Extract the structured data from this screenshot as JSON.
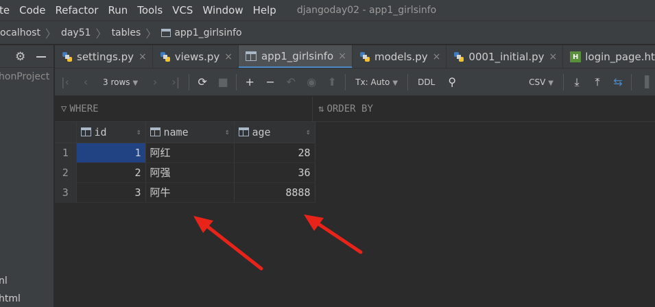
{
  "menu": {
    "items": [
      "te",
      "Code",
      "Refactor",
      "Run",
      "Tools",
      "VCS",
      "Window",
      "Help"
    ],
    "window_title": "djangoday02 - app1_girlsinfo"
  },
  "breadcrumb": {
    "items": [
      "ocalhost",
      "day51",
      "tables",
      "app1_girlsinfo"
    ]
  },
  "project_panel": {
    "project_label": "honProject",
    "file1": "nl",
    "file2": "html"
  },
  "tabs": [
    {
      "label": "settings.py",
      "icon": "python-file-icon",
      "close": "×"
    },
    {
      "label": "views.py",
      "icon": "python-file-icon",
      "close": "×"
    },
    {
      "label": "app1_girlsinfo",
      "icon": "table-icon",
      "close": "×",
      "active": true
    },
    {
      "label": "models.py",
      "icon": "python-file-icon",
      "close": "×"
    },
    {
      "label": "0001_initial.py",
      "icon": "python-file-icon",
      "close": "×"
    },
    {
      "label": "login_page.ht",
      "icon": "html-file-icon"
    }
  ],
  "toolbar": {
    "rows_label": "3 rows",
    "tx_label": "Tx: Auto",
    "ddl_label": "DDL",
    "export_label": "CSV"
  },
  "filter": {
    "where_label": "WHERE",
    "orderby_label": "ORDER BY"
  },
  "table": {
    "columns": [
      "id",
      "name",
      "age"
    ],
    "rows": [
      {
        "num": "1",
        "id": "1",
        "name": "阿红",
        "age": "28"
      },
      {
        "num": "2",
        "id": "2",
        "name": "阿强",
        "age": "36"
      },
      {
        "num": "3",
        "id": "3",
        "name": "阿牛",
        "age": "8888"
      }
    ]
  },
  "colors": {
    "accent": "#4a88c7",
    "selection": "#214283",
    "annotation_arrow": "#e8231a"
  }
}
